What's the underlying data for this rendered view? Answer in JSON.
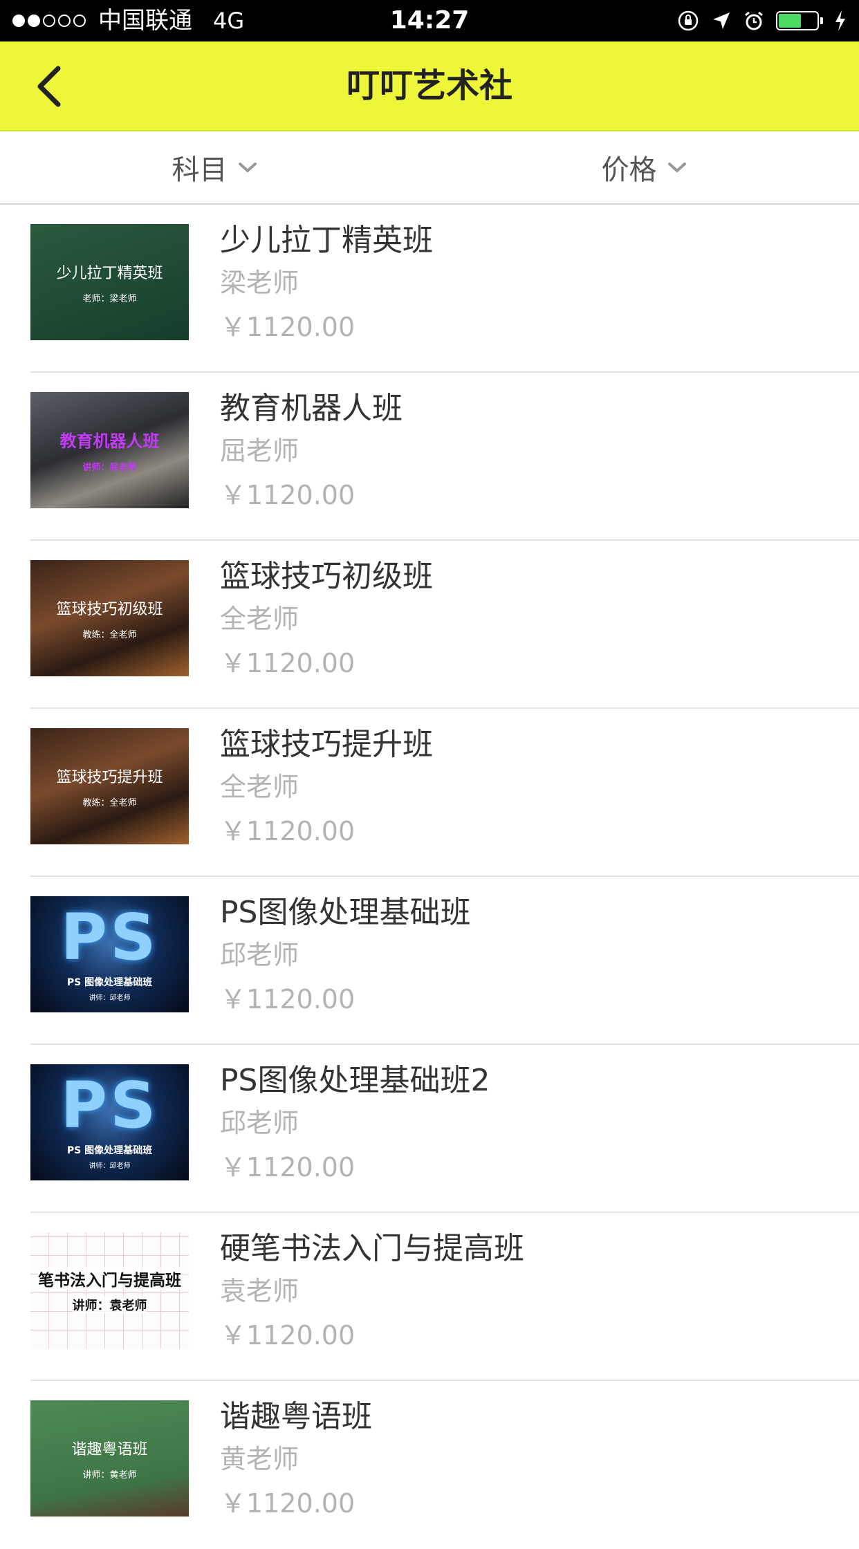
{
  "status_bar": {
    "carrier": "中国联通",
    "network": "4G",
    "time": "14:27",
    "signal_filled": 2,
    "signal_total": 5,
    "battery_level": 0.6,
    "battery_color": "#4cd964"
  },
  "nav": {
    "title": "叮叮艺术社",
    "back_icon": "chevron-left-icon",
    "background_color": "#eef63a"
  },
  "filters": {
    "subject_label": "科目",
    "price_label": "价格",
    "dropdown_icon": "chevron-down-icon"
  },
  "courses": [
    {
      "thumb_title": "少儿拉丁精英班",
      "thumb_sub": "老师：梁老师",
      "title": "少儿拉丁精英班",
      "teacher": "梁老师",
      "price": "￥1120.00"
    },
    {
      "thumb_title": "教育机器人班",
      "thumb_sub": "讲师：屈老师",
      "title": "教育机器人班",
      "teacher": "屈老师",
      "price": "￥1120.00"
    },
    {
      "thumb_title": "篮球技巧初级班",
      "thumb_sub": "教练：全老师",
      "title": "篮球技巧初级班",
      "teacher": "全老师",
      "price": "￥1120.00"
    },
    {
      "thumb_title": "篮球技巧提升班",
      "thumb_sub": "教练：全老师",
      "title": "篮球技巧提升班",
      "teacher": "全老师",
      "price": "￥1120.00"
    },
    {
      "thumb_big": "PS",
      "thumb_title": "PS 图像处理基础班",
      "thumb_sub": "讲师：邱老师",
      "title": "PS图像处理基础班",
      "teacher": "邱老师",
      "price": "￥1120.00"
    },
    {
      "thumb_big": "PS",
      "thumb_title": "PS 图像处理基础班",
      "thumb_sub": "讲师：邱老师",
      "title": "PS图像处理基础班2",
      "teacher": "邱老师",
      "price": "￥1120.00"
    },
    {
      "thumb_title": "笔书法入门与提高班",
      "thumb_sub": "讲师：袁老师",
      "title": "硬笔书法入门与提高班",
      "teacher": "袁老师",
      "price": "￥1120.00"
    },
    {
      "thumb_title": "谐趣粤语班",
      "thumb_sub": "讲师：黄老师",
      "title": "谐趣粤语班",
      "teacher": "黄老师",
      "price": "￥1120.00"
    }
  ]
}
